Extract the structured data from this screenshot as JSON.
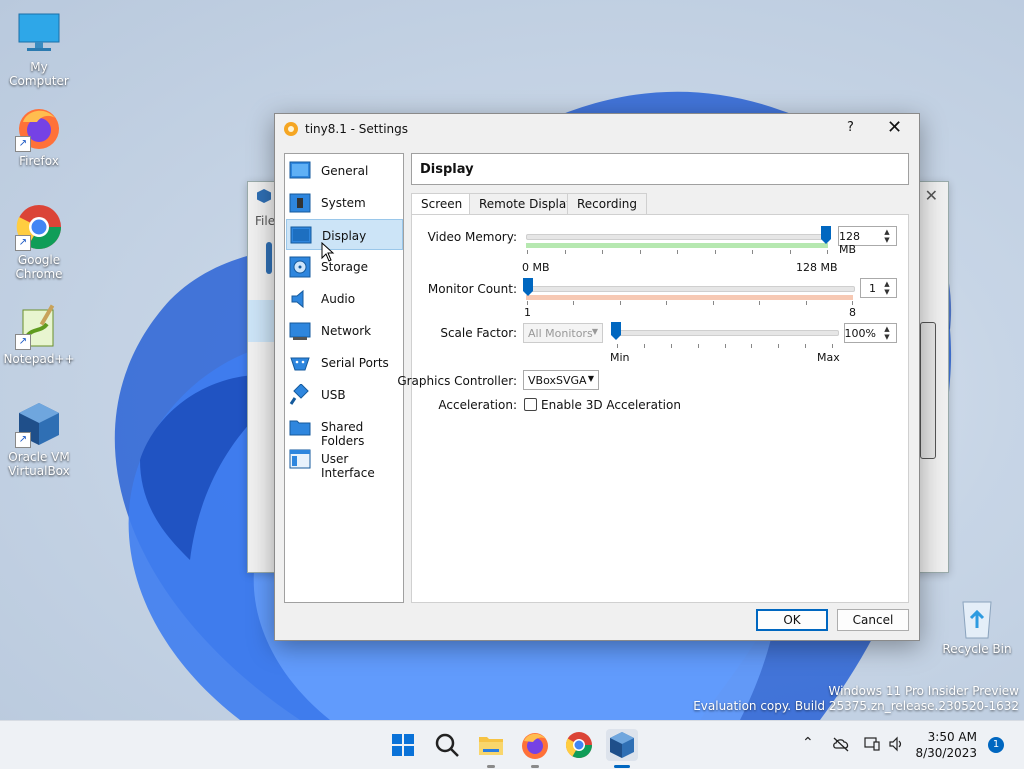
{
  "desktop": {
    "icons": [
      {
        "label": "My Computer"
      },
      {
        "label": "Firefox"
      },
      {
        "label": "Google Chrome"
      },
      {
        "label": "Notepad++"
      },
      {
        "label": "Oracle VM VirtualBox"
      }
    ],
    "recycle_bin": "Recycle Bin",
    "watermark_line1": "Windows 11 Pro Insider Preview",
    "watermark_line2": "Evaluation copy. Build 25375.zn_release.230520-1632"
  },
  "background_window": {
    "menu_fragment": "File"
  },
  "dialog": {
    "title": "tiny8.1 - Settings",
    "help": "?",
    "close": "✕",
    "sidebar": [
      {
        "label": "General",
        "icon": "general-icon"
      },
      {
        "label": "System",
        "icon": "system-icon"
      },
      {
        "label": "Display",
        "icon": "display-icon",
        "selected": true
      },
      {
        "label": "Storage",
        "icon": "storage-icon"
      },
      {
        "label": "Audio",
        "icon": "audio-icon"
      },
      {
        "label": "Network",
        "icon": "network-icon"
      },
      {
        "label": "Serial Ports",
        "icon": "serial-ports-icon"
      },
      {
        "label": "USB",
        "icon": "usb-icon"
      },
      {
        "label": "Shared Folders",
        "icon": "shared-folders-icon"
      },
      {
        "label": "User Interface",
        "icon": "user-interface-icon"
      }
    ],
    "panel_title": "Display",
    "tabs": [
      {
        "label": "Screen",
        "selected": true
      },
      {
        "label": "Remote Display"
      },
      {
        "label": "Recording"
      }
    ],
    "screen": {
      "video_memory_label": "Video Memory:",
      "video_memory_value": "128 MB",
      "video_memory_min": "0 MB",
      "video_memory_max": "128 MB",
      "video_memory_fraction": 1.0,
      "monitor_count_label": "Monitor Count:",
      "monitor_count_value": "1",
      "monitor_count_min": "1",
      "monitor_count_max": "8",
      "scale_factor_label": "Scale Factor:",
      "scale_factor_combo": "All Monitors",
      "scale_factor_value": "100%",
      "scale_factor_min": "Min",
      "scale_factor_max": "Max",
      "graphics_controller_label": "Graphics Controller:",
      "graphics_controller_value": "VBoxSVGA",
      "acceleration_label": "Acceleration:",
      "enable_3d_label": "Enable 3D Acceleration",
      "enable_3d_checked": false
    },
    "ok": "OK",
    "cancel": "Cancel"
  },
  "taskbar": {
    "apps": [
      "start-icon",
      "search-icon",
      "file-explorer-icon",
      "firefox-icon",
      "chrome-icon",
      "virtualbox-icon"
    ],
    "time": "3:50 AM",
    "date": "8/30/2023",
    "notification_count": "1"
  },
  "colors": {
    "accent": "#0067c0",
    "selection": "#cce4f7",
    "green_zone": "#b6e8b0",
    "orange_zone": "#f7c9b4"
  }
}
